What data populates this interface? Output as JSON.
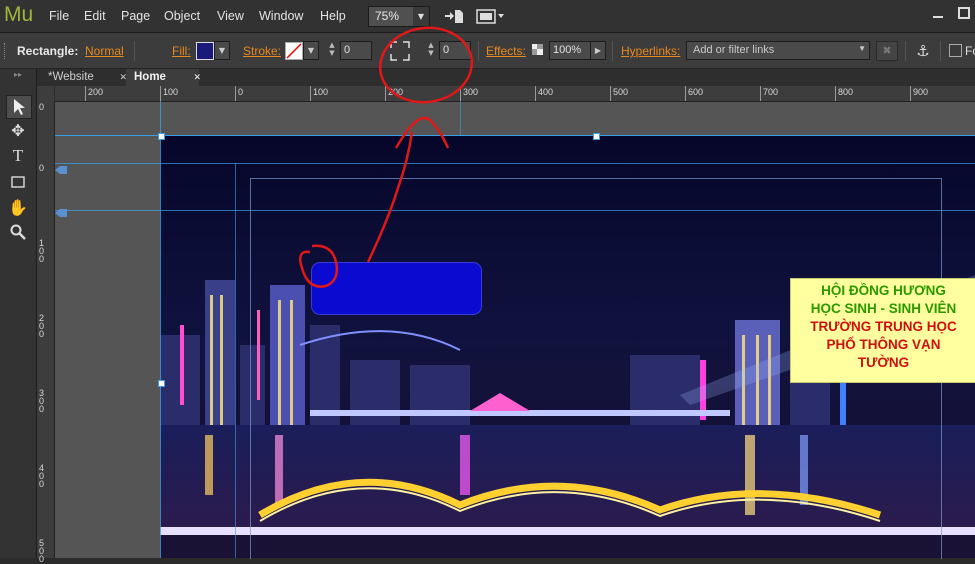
{
  "app": {
    "logo": "Mu"
  },
  "menu": [
    "File",
    "Edit",
    "Page",
    "Object",
    "View",
    "Window",
    "Help"
  ],
  "zoom": {
    "value": "75%"
  },
  "controlbar": {
    "element_type": "Rectangle:",
    "element_state": "Normal",
    "fill_label": "Fill:",
    "stroke_label": "Stroke:",
    "stroke_value": "0",
    "corner_value": "0",
    "effects_label": "Effects:",
    "effects_value": "100%",
    "hyperlinks_label": "Hyperlinks:",
    "hyperlinks_placeholder": "Add or filter links",
    "extra_label": "Fo"
  },
  "tabs": [
    {
      "label": "*Website",
      "close": "✕",
      "active": false
    },
    {
      "label": "Home",
      "close": "✕",
      "active": true
    }
  ],
  "hruler": [
    "200",
    "100",
    "0",
    "100",
    "200",
    "300",
    "400",
    "500",
    "600",
    "700",
    "800",
    "900"
  ],
  "vruler": [
    "0",
    "0",
    "100",
    "200",
    "300",
    "400",
    "500"
  ],
  "yellowbox": {
    "lines": [
      {
        "text": "HỘI ĐỒNG HƯƠNG",
        "color": "#2a9a00"
      },
      {
        "text": "HỌC SINH - SINH VIÊN",
        "color": "#2a9a00"
      },
      {
        "text": "TRƯỜNG TRUNG HỌC",
        "color": "#d01010"
      },
      {
        "text": "PHỔ THÔNG VẠN",
        "color": "#d01010"
      },
      {
        "text": "TƯỜNG",
        "color": "#d01010"
      }
    ]
  },
  "colors": {
    "accent": "#e6891e",
    "logo": "#9fb43a",
    "guide": "#3aa0e8"
  }
}
